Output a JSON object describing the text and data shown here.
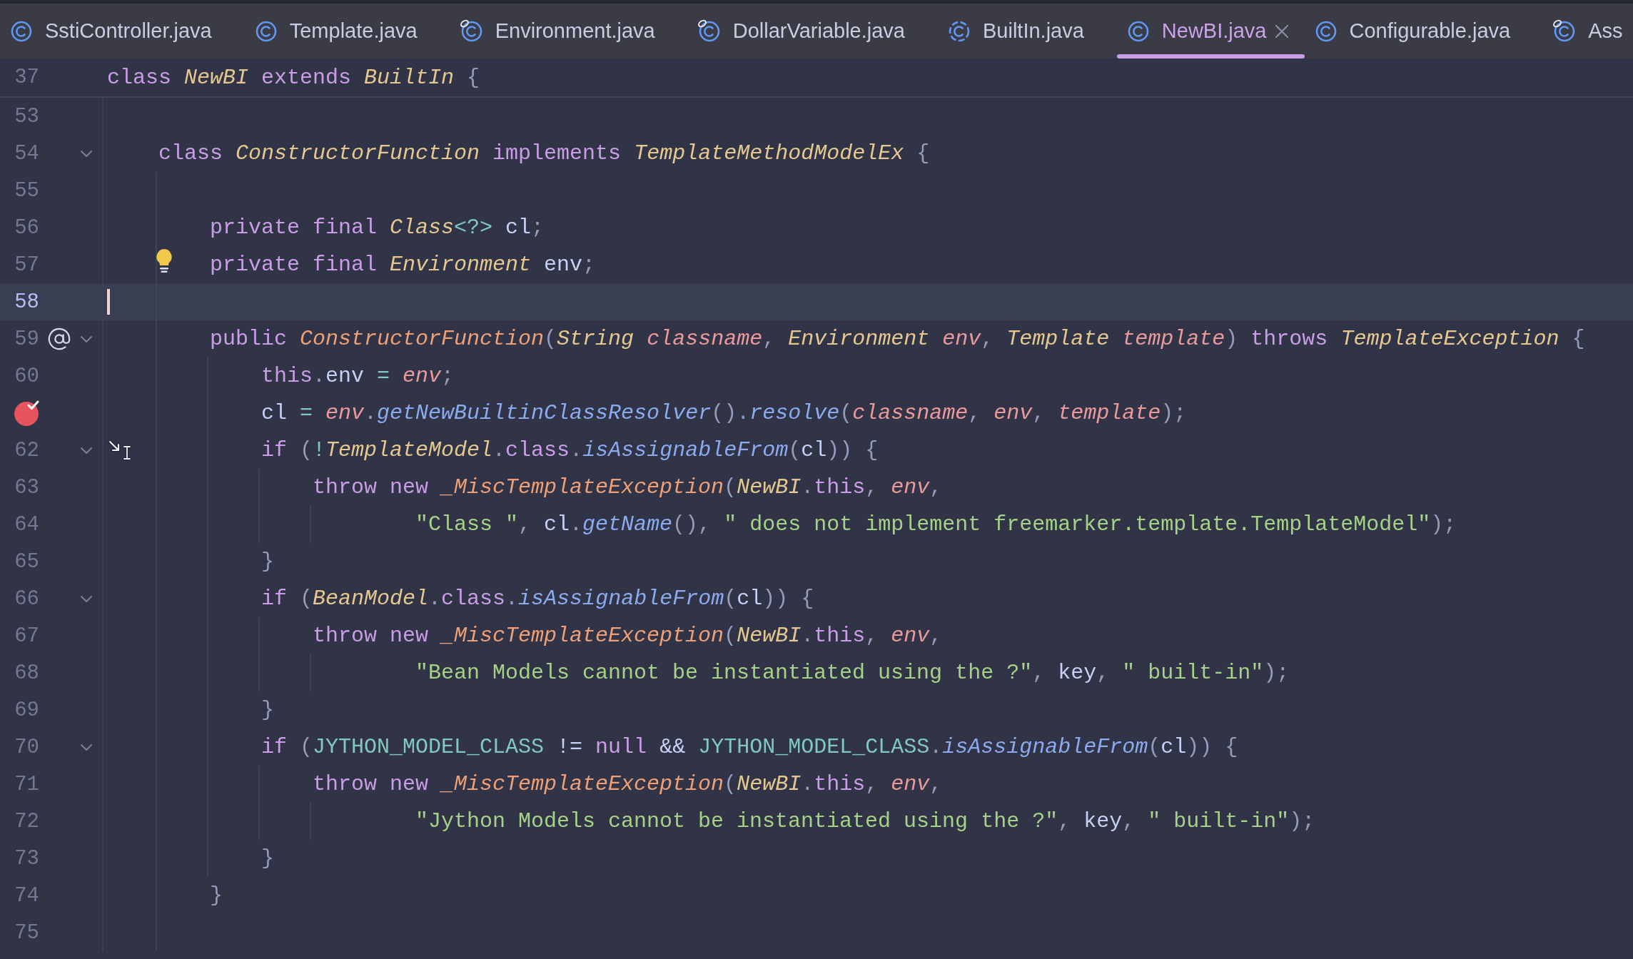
{
  "tabs": [
    {
      "label": "SstiController.java",
      "kind": "class",
      "library": false,
      "selected": false
    },
    {
      "label": "Template.java",
      "kind": "class",
      "library": false,
      "selected": false
    },
    {
      "label": "Environment.java",
      "kind": "class",
      "library": true,
      "selected": false
    },
    {
      "label": "DollarVariable.java",
      "kind": "class",
      "library": true,
      "selected": false
    },
    {
      "label": "BuiltIn.java",
      "kind": "abstract_class",
      "library": false,
      "selected": false
    },
    {
      "label": "NewBI.java",
      "kind": "class",
      "library": false,
      "selected": true
    },
    {
      "label": "Configurable.java",
      "kind": "class",
      "library": false,
      "selected": false
    },
    {
      "label": "Ass",
      "kind": "class",
      "library": true,
      "selected": false
    }
  ],
  "sticky_line": {
    "number": "37",
    "tokens": [
      {
        "kind": "kw",
        "text": "class "
      },
      {
        "kind": "type",
        "text": "NewBI"
      },
      {
        "kind": "kw",
        "text": " extends "
      },
      {
        "kind": "type",
        "text": "BuiltIn"
      },
      {
        "kind": "punct",
        "text": " {"
      }
    ]
  },
  "lines": [
    {
      "number": "53",
      "fold": false,
      "breakpoint": false,
      "current": false,
      "bulb": false,
      "at_mark": false,
      "pointer": false
    },
    {
      "number": "54",
      "fold": true,
      "breakpoint": false,
      "current": false,
      "bulb": false,
      "at_mark": false,
      "pointer": false,
      "tokens": [
        {
          "kind": "kw",
          "text": "    class "
        },
        {
          "kind": "type",
          "text": "ConstructorFunction"
        },
        {
          "kind": "kw",
          "text": " implements "
        },
        {
          "kind": "type",
          "text": "TemplateMethodModelEx"
        },
        {
          "kind": "punct",
          "text": " {"
        }
      ]
    },
    {
      "number": "55",
      "fold": false,
      "breakpoint": false,
      "current": false,
      "bulb": false,
      "at_mark": false,
      "pointer": false
    },
    {
      "number": "56",
      "fold": false,
      "breakpoint": false,
      "current": false,
      "bulb": false,
      "at_mark": false,
      "pointer": false,
      "tokens": [
        {
          "kind": "kw",
          "text": "        private final "
        },
        {
          "kind": "type",
          "text": "Class"
        },
        {
          "kind": "op",
          "text": "<?>"
        },
        {
          "kind": "field",
          "text": " cl"
        },
        {
          "kind": "punct",
          "text": ";"
        }
      ]
    },
    {
      "number": "57",
      "fold": false,
      "breakpoint": false,
      "current": false,
      "bulb": true,
      "at_mark": false,
      "pointer": false,
      "tokens": [
        {
          "kind": "kw",
          "text": "        private final "
        },
        {
          "kind": "type",
          "text": "Environment"
        },
        {
          "kind": "field",
          "text": " env"
        },
        {
          "kind": "punct",
          "text": ";"
        }
      ]
    },
    {
      "number": "58",
      "fold": false,
      "breakpoint": false,
      "current": true,
      "bulb": false,
      "at_mark": false,
      "pointer": false
    },
    {
      "number": "59",
      "fold": true,
      "breakpoint": false,
      "current": false,
      "bulb": false,
      "at_mark": true,
      "pointer": false,
      "tokens": [
        {
          "kind": "kw",
          "text": "        public "
        },
        {
          "kind": "ctor",
          "text": "ConstructorFunction"
        },
        {
          "kind": "punct",
          "text": "("
        },
        {
          "kind": "type",
          "text": "String "
        },
        {
          "kind": "param",
          "text": "classname"
        },
        {
          "kind": "punct",
          "text": ", "
        },
        {
          "kind": "type",
          "text": "Environment "
        },
        {
          "kind": "param",
          "text": "env"
        },
        {
          "kind": "punct",
          "text": ", "
        },
        {
          "kind": "type",
          "text": "Template "
        },
        {
          "kind": "param",
          "text": "template"
        },
        {
          "kind": "punct",
          "text": ") "
        },
        {
          "kind": "kw",
          "text": "throws "
        },
        {
          "kind": "type",
          "text": "TemplateException"
        },
        {
          "kind": "punct",
          "text": " {"
        }
      ]
    },
    {
      "number": "60",
      "fold": false,
      "breakpoint": false,
      "current": false,
      "bulb": false,
      "at_mark": false,
      "pointer": false,
      "tokens": [
        {
          "kind": "kw",
          "text": "            this"
        },
        {
          "kind": "punct",
          "text": "."
        },
        {
          "kind": "field",
          "text": "env "
        },
        {
          "kind": "op",
          "text": "="
        },
        {
          "kind": "param",
          "text": " env"
        },
        {
          "kind": "punct",
          "text": ";"
        }
      ]
    },
    {
      "fold": false,
      "breakpoint": true,
      "current": false,
      "bulb": false,
      "at_mark": false,
      "pointer": false,
      "tokens": [
        {
          "kind": "field",
          "text": "            cl "
        },
        {
          "kind": "op",
          "text": "="
        },
        {
          "kind": "param",
          "text": " env"
        },
        {
          "kind": "punct",
          "text": "."
        },
        {
          "kind": "method",
          "text": "getNewBuiltinClassResolver"
        },
        {
          "kind": "punct",
          "text": "()."
        },
        {
          "kind": "method",
          "text": "resolve"
        },
        {
          "kind": "punct",
          "text": "("
        },
        {
          "kind": "param",
          "text": "classname"
        },
        {
          "kind": "punct",
          "text": ", "
        },
        {
          "kind": "param",
          "text": "env"
        },
        {
          "kind": "punct",
          "text": ", "
        },
        {
          "kind": "param",
          "text": "template"
        },
        {
          "kind": "punct",
          "text": ");"
        }
      ]
    },
    {
      "number": "62",
      "fold": true,
      "breakpoint": false,
      "current": false,
      "bulb": false,
      "at_mark": false,
      "pointer": true,
      "tokens": [
        {
          "kind": "kw",
          "text": "            if "
        },
        {
          "kind": "punct",
          "text": "("
        },
        {
          "kind": "op",
          "text": "!"
        },
        {
          "kind": "type",
          "text": "TemplateModel"
        },
        {
          "kind": "punct",
          "text": "."
        },
        {
          "kind": "kw",
          "text": "class"
        },
        {
          "kind": "punct",
          "text": "."
        },
        {
          "kind": "method",
          "text": "isAssignableFrom"
        },
        {
          "kind": "punct",
          "text": "("
        },
        {
          "kind": "field",
          "text": "cl"
        },
        {
          "kind": "punct",
          "text": ")) {"
        }
      ]
    },
    {
      "number": "63",
      "fold": false,
      "breakpoint": false,
      "current": false,
      "bulb": false,
      "at_mark": false,
      "pointer": false,
      "tokens": [
        {
          "kind": "kw",
          "text": "                throw new "
        },
        {
          "kind": "ctor",
          "text": "_MiscTemplateException"
        },
        {
          "kind": "punct",
          "text": "("
        },
        {
          "kind": "type",
          "text": "NewBI"
        },
        {
          "kind": "punct",
          "text": "."
        },
        {
          "kind": "kw",
          "text": "this"
        },
        {
          "kind": "punct",
          "text": ", "
        },
        {
          "kind": "param",
          "text": "env"
        },
        {
          "kind": "punct",
          "text": ","
        }
      ]
    },
    {
      "number": "64",
      "fold": false,
      "breakpoint": false,
      "current": false,
      "bulb": false,
      "at_mark": false,
      "pointer": false,
      "tokens": [
        {
          "kind": "str",
          "text": "                        \"Class \""
        },
        {
          "kind": "punct",
          "text": ", "
        },
        {
          "kind": "field",
          "text": "cl"
        },
        {
          "kind": "punct",
          "text": "."
        },
        {
          "kind": "method",
          "text": "getName"
        },
        {
          "kind": "punct",
          "text": "(), "
        },
        {
          "kind": "str",
          "text": "\" does not implement freemarker.template.TemplateModel\""
        },
        {
          "kind": "punct",
          "text": ");"
        }
      ]
    },
    {
      "number": "65",
      "fold": false,
      "breakpoint": false,
      "current": false,
      "bulb": false,
      "at_mark": false,
      "pointer": false,
      "tokens": [
        {
          "kind": "punct",
          "text": "            }"
        }
      ]
    },
    {
      "number": "66",
      "fold": true,
      "breakpoint": false,
      "current": false,
      "bulb": false,
      "at_mark": false,
      "pointer": false,
      "tokens": [
        {
          "kind": "kw",
          "text": "            if "
        },
        {
          "kind": "punct",
          "text": "("
        },
        {
          "kind": "type",
          "text": "BeanModel"
        },
        {
          "kind": "punct",
          "text": "."
        },
        {
          "kind": "kw",
          "text": "class"
        },
        {
          "kind": "punct",
          "text": "."
        },
        {
          "kind": "method",
          "text": "isAssignableFrom"
        },
        {
          "kind": "punct",
          "text": "("
        },
        {
          "kind": "field",
          "text": "cl"
        },
        {
          "kind": "punct",
          "text": ")) {"
        }
      ]
    },
    {
      "number": "67",
      "fold": false,
      "breakpoint": false,
      "current": false,
      "bulb": false,
      "at_mark": false,
      "pointer": false,
      "tokens": [
        {
          "kind": "kw",
          "text": "                throw new "
        },
        {
          "kind": "ctor",
          "text": "_MiscTemplateException"
        },
        {
          "kind": "punct",
          "text": "("
        },
        {
          "kind": "type",
          "text": "NewBI"
        },
        {
          "kind": "punct",
          "text": "."
        },
        {
          "kind": "kw",
          "text": "this"
        },
        {
          "kind": "punct",
          "text": ", "
        },
        {
          "kind": "param",
          "text": "env"
        },
        {
          "kind": "punct",
          "text": ","
        }
      ]
    },
    {
      "number": "68",
      "fold": false,
      "breakpoint": false,
      "current": false,
      "bulb": false,
      "at_mark": false,
      "pointer": false,
      "tokens": [
        {
          "kind": "str",
          "text": "                        \"Bean Models cannot be instantiated using the ?\""
        },
        {
          "kind": "punct",
          "text": ", "
        },
        {
          "kind": "field",
          "text": "key"
        },
        {
          "kind": "punct",
          "text": ", "
        },
        {
          "kind": "str",
          "text": "\" built-in\""
        },
        {
          "kind": "punct",
          "text": ");"
        }
      ]
    },
    {
      "number": "69",
      "fold": false,
      "breakpoint": false,
      "current": false,
      "bulb": false,
      "at_mark": false,
      "pointer": false,
      "tokens": [
        {
          "kind": "punct",
          "text": "            }"
        }
      ]
    },
    {
      "number": "70",
      "fold": true,
      "breakpoint": false,
      "current": false,
      "bulb": false,
      "at_mark": false,
      "pointer": false,
      "tokens": [
        {
          "kind": "kw",
          "text": "            if "
        },
        {
          "kind": "punct",
          "text": "("
        },
        {
          "kind": "const",
          "text": "JYTHON_MODEL_CLASS"
        },
        {
          "kind": "field",
          "text": " != "
        },
        {
          "kind": "kw",
          "text": "null"
        },
        {
          "kind": "field",
          "text": " && "
        },
        {
          "kind": "const",
          "text": "JYTHON_MODEL_CLASS"
        },
        {
          "kind": "punct",
          "text": "."
        },
        {
          "kind": "method",
          "text": "isAssignableFrom"
        },
        {
          "kind": "punct",
          "text": "("
        },
        {
          "kind": "field",
          "text": "cl"
        },
        {
          "kind": "punct",
          "text": ")) {"
        }
      ]
    },
    {
      "number": "71",
      "fold": false,
      "breakpoint": false,
      "current": false,
      "bulb": false,
      "at_mark": false,
      "pointer": false,
      "tokens": [
        {
          "kind": "kw",
          "text": "                throw new "
        },
        {
          "kind": "ctor",
          "text": "_MiscTemplateException"
        },
        {
          "kind": "punct",
          "text": "("
        },
        {
          "kind": "type",
          "text": "NewBI"
        },
        {
          "kind": "punct",
          "text": "."
        },
        {
          "kind": "kw",
          "text": "this"
        },
        {
          "kind": "punct",
          "text": ", "
        },
        {
          "kind": "param",
          "text": "env"
        },
        {
          "kind": "punct",
          "text": ","
        }
      ]
    },
    {
      "number": "72",
      "fold": false,
      "breakpoint": false,
      "current": false,
      "bulb": false,
      "at_mark": false,
      "pointer": false,
      "tokens": [
        {
          "kind": "str",
          "text": "                        \"Jython Models cannot be instantiated using the ?\""
        },
        {
          "kind": "punct",
          "text": ", "
        },
        {
          "kind": "field",
          "text": "key"
        },
        {
          "kind": "punct",
          "text": ", "
        },
        {
          "kind": "str",
          "text": "\" built-in\""
        },
        {
          "kind": "punct",
          "text": ");"
        }
      ]
    },
    {
      "number": "73",
      "fold": false,
      "breakpoint": false,
      "current": false,
      "bulb": false,
      "at_mark": false,
      "pointer": false,
      "tokens": [
        {
          "kind": "punct",
          "text": "            }"
        }
      ]
    },
    {
      "number": "74",
      "fold": false,
      "breakpoint": false,
      "current": false,
      "bulb": false,
      "at_mark": false,
      "pointer": false,
      "tokens": [
        {
          "kind": "punct",
          "text": "        }"
        }
      ]
    },
    {
      "number": "75",
      "fold": false,
      "breakpoint": false,
      "current": false,
      "bulb": false,
      "at_mark": false,
      "pointer": false
    }
  ]
}
